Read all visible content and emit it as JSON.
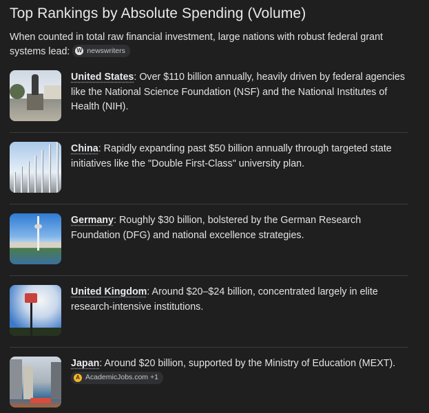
{
  "heading": "Top Rankings by Absolute Spending (Volume)",
  "intro": {
    "text": "When counted in total raw financial investment, large nations with robust federal grant systems lead:",
    "source_chip": "newswriters"
  },
  "items": [
    {
      "name": "United States",
      "text": " Over $110 billion annually, heavily driven by federal agencies like the National Science Foundation (NSF) and the National Institutes of Health (NIH).",
      "thumbnail_icon": "landmark-statue-photo"
    },
    {
      "name": "China",
      "text": " Rapidly expanding past $50 billion annually through targeted state initiatives like the \"Double First-Class\" university plan.",
      "thumbnail_icon": "columns-photo"
    },
    {
      "name": "Germany",
      "text": " Roughly $30 billion, bolstered by the German Research Foundation (DFG) and national excellence strategies.",
      "thumbnail_icon": "tower-cityscape-photo"
    },
    {
      "name": "United Kingdom",
      "text": " Around $20–$24 billion, concentrated largely in elite research-intensive institutions.",
      "thumbnail_icon": "street-sign-photo"
    },
    {
      "name": "Japan",
      "text": " Around $20 billion, supported by the Ministry of Education (MEXT).",
      "thumbnail_icon": "canal-city-photo",
      "source_chip": "AcademicJobs.com +1"
    }
  ],
  "colors": {
    "background": "#1f1f1f",
    "text": "#e3e3e3",
    "chip_bg": "#2f3033",
    "divider": "#3c3c3c"
  }
}
